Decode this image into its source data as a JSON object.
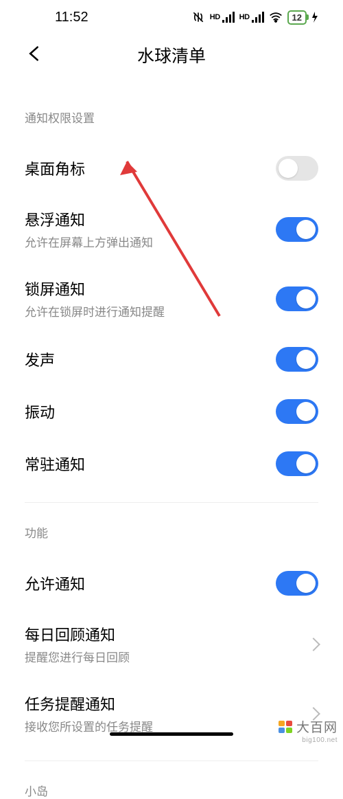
{
  "status": {
    "time": "11:52",
    "battery": "12"
  },
  "header": {
    "title": "水球清单"
  },
  "section1": {
    "label": "通知权限设置"
  },
  "items1": {
    "badge": {
      "title": "桌面角标",
      "on": false
    },
    "float": {
      "title": "悬浮通知",
      "sub": "允许在屏幕上方弹出通知",
      "on": true
    },
    "lock": {
      "title": "锁屏通知",
      "sub": "允许在锁屏时进行通知提醒",
      "on": true
    },
    "sound": {
      "title": "发声",
      "on": true
    },
    "vibrate": {
      "title": "振动",
      "on": true
    },
    "persistent": {
      "title": "常驻通知",
      "on": true
    }
  },
  "section2": {
    "label": "功能"
  },
  "items2": {
    "allow": {
      "title": "允许通知",
      "on": true
    },
    "daily": {
      "title": "每日回顾通知",
      "sub": "提醒您进行每日回顾"
    },
    "task": {
      "title": "任务提醒通知",
      "sub": "接收您所设置的任务提醒"
    }
  },
  "section3": {
    "label": "小岛"
  },
  "watermark": {
    "text": "大百网",
    "url": "big100.net"
  }
}
